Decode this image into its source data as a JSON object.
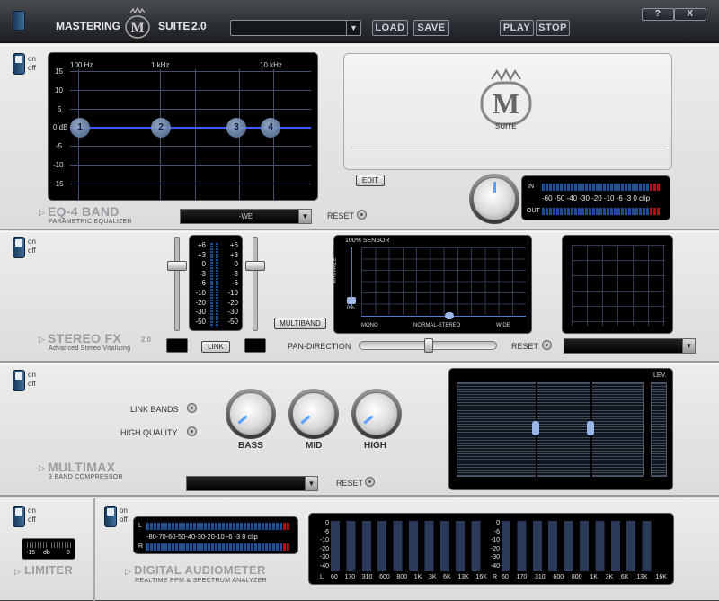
{
  "titlebar": {
    "word1": "MASTERING",
    "word2": "SUITE",
    "version": "2.0",
    "preset_value": "",
    "load": "LOAD",
    "save": "SAVE",
    "play": "PLAY",
    "stop": "STOP",
    "help": "?",
    "close": "X"
  },
  "onoff": {
    "on": "on",
    "off": "off"
  },
  "eq": {
    "title": "EQ-4 BAND",
    "subtitle": "PARAMETRIC EQUALIZER",
    "freq_labels": [
      "100 Hz",
      "1 kHz",
      "10 kHz"
    ],
    "db_labels": [
      "15",
      "10",
      "5",
      "0 dB",
      "-5",
      "-10",
      "-15"
    ],
    "bands": [
      "1",
      "2",
      "3",
      "4"
    ],
    "preset": "-WE",
    "reset": "RESET"
  },
  "logo": {
    "text": "SUITE",
    "edit": "EDIT"
  },
  "io_meter": {
    "in": "IN",
    "out": "OUT",
    "scale": "-60 -50 -40 -30 -20 -10  -6   -3   0  clip"
  },
  "stereo": {
    "title": "STEREO FX",
    "version": "2.0",
    "subtitle": "Advanced Stereo Vitalizing",
    "scale_left": [
      "+6",
      "+3",
      "0",
      "-3",
      "-6",
      "-10",
      "-20",
      "-30",
      "-50"
    ],
    "scale_right": [
      "+6",
      "+3",
      "0",
      "-3",
      "-6",
      "-10",
      "-20",
      "-30",
      "-50"
    ],
    "link": "LINK",
    "multiband": "MULTIBAND",
    "sensor": "100% SENSOR",
    "maximize": "MAXIMIZE",
    "zero": "0%",
    "mono": "MONO",
    "normal": "NORMAL-STEREO",
    "wide": "WIDE",
    "pan": "PAN-DIRECTION",
    "reset": "RESET"
  },
  "multimax": {
    "title": "MULTIMAX",
    "subtitle": "3 BAND COMPRESSOR",
    "link_bands": "LINK BANDS",
    "high_quality": "HIGH QUALITY",
    "bass": "BASS",
    "mid": "MID",
    "high": "HIGH",
    "reset": "RESET",
    "lev": "LEV."
  },
  "limiter": {
    "title": "LIMITER",
    "value": "-15",
    "unit": "db",
    "zero": "0"
  },
  "audiometer": {
    "title": "DIGITAL AUDIOMETER",
    "subtitle": "REALTIME PPM & SPECTRUM ANALYZER",
    "l": "L",
    "r": "R",
    "scale": "-80-70-60-50-40-30-20-10  -6  -3   0   clip",
    "spectrum_db": [
      "0",
      "-6",
      "-10",
      "-20",
      "-30",
      "-40"
    ],
    "freqs": [
      "60",
      "170",
      "310",
      "600",
      "800",
      "1K",
      "3K",
      "6K",
      "13K",
      "16K"
    ]
  }
}
